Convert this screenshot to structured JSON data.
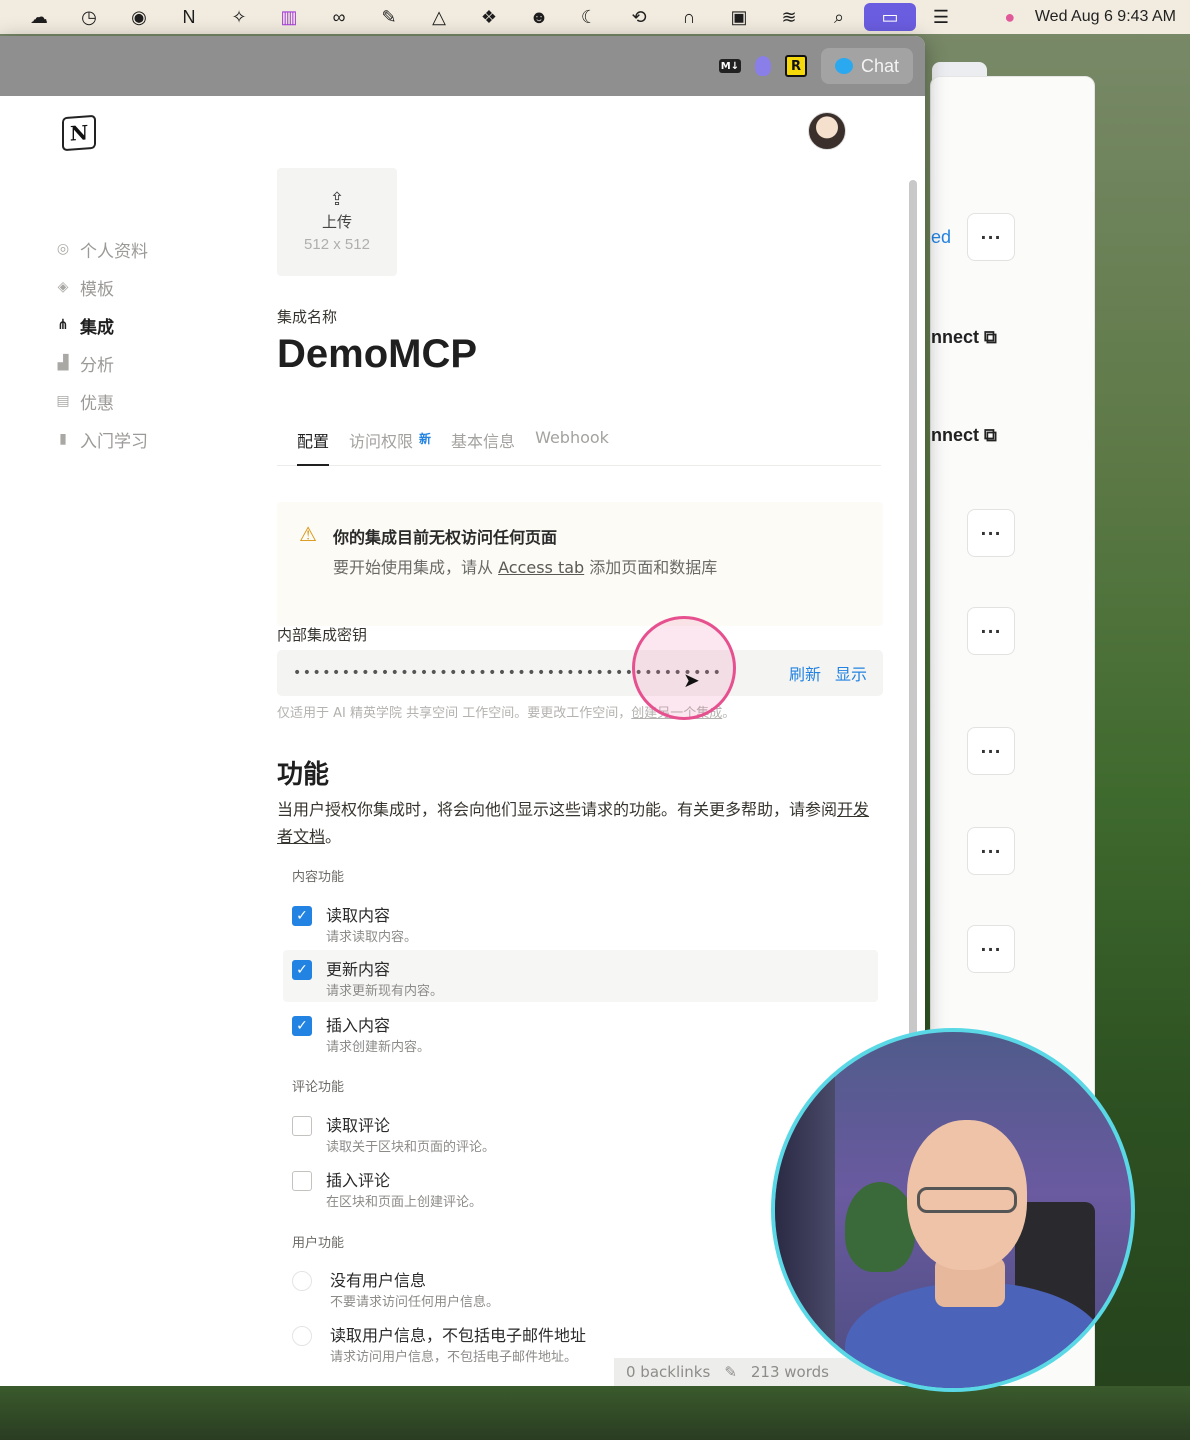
{
  "menubar": {
    "icons": [
      "creative-cloud-icon",
      "clock-icon",
      "pockity-icon",
      "notion-icon",
      "bartender-icon",
      "istat-icon",
      "link-icon",
      "pen-icon",
      "drive-icon",
      "dropbox-icon",
      "face-icon",
      "moon-icon",
      "time-machine-icon",
      "headphones-icon",
      "mirror-icon",
      "wifi-icon",
      "search-icon",
      "screen-share-icon",
      "control-center-icon",
      "siri-icon"
    ],
    "datetime": "Wed Aug 6  9:43 AM"
  },
  "toolbar": {
    "md_badge": "M↓",
    "r_badge": "R",
    "chat_label": "Chat"
  },
  "sidebar": {
    "items": [
      {
        "label": "个人资料",
        "icon": "person-icon"
      },
      {
        "label": "模板",
        "icon": "template-icon"
      },
      {
        "label": "集成",
        "icon": "integration-icon",
        "active": true
      },
      {
        "label": "分析",
        "icon": "analytics-icon"
      },
      {
        "label": "优惠",
        "icon": "offers-icon"
      },
      {
        "label": "入门学习",
        "icon": "book-icon"
      }
    ]
  },
  "upload": {
    "label": "上传",
    "size": "512 x 512"
  },
  "integration": {
    "name_label": "集成名称",
    "name": "DemoMCP"
  },
  "tabs": [
    {
      "label": "配置",
      "active": true
    },
    {
      "label": "访问权限",
      "badge": "新"
    },
    {
      "label": "基本信息"
    },
    {
      "label": "Webhook"
    }
  ],
  "warning": {
    "title": "你的集成目前无权访问任何页面",
    "body_prefix": "要开始使用集成，请从 ",
    "link": "Access tab",
    "body_suffix": " 添加页面和数据库"
  },
  "secret": {
    "label": "内部集成密钥",
    "masked": "••••••••••••••••••••••••••••••••••••••••••••",
    "refresh": "刷新",
    "show": "显示",
    "hint_prefix": "仅适用于 AI 精英学院 共享空间 工作空间。要更改工作空间，",
    "hint_link": "创建另一个集成",
    "hint_suffix": "。"
  },
  "features": {
    "title": "功能",
    "desc_prefix": "当用户授权你集成时，将会向他们显示这些请求的功能。有关更多帮助，请参阅",
    "desc_link": "开发者文档",
    "desc_suffix": "。",
    "content_label": "内容功能",
    "content": [
      {
        "title": "读取内容",
        "desc": "请求读取内容。",
        "checked": true
      },
      {
        "title": "更新内容",
        "desc": "请求更新现有内容。",
        "checked": true
      },
      {
        "title": "插入内容",
        "desc": "请求创建新内容。",
        "checked": true
      }
    ],
    "comment_label": "评论功能",
    "comment": [
      {
        "title": "读取评论",
        "desc": "读取关于区块和页面的评论。",
        "checked": false
      },
      {
        "title": "插入评论",
        "desc": "在区块和页面上创建评论。",
        "checked": false
      }
    ],
    "user_label": "用户功能",
    "user": [
      {
        "title": "没有用户信息",
        "desc": "不要请求访问任何用户信息。"
      },
      {
        "title": "读取用户信息，不包括电子邮件地址",
        "desc": "请求访问用户信息，不包括电子邮件地址。"
      }
    ]
  },
  "footer": {
    "backlinks": "0 backlinks",
    "words": "213 words"
  },
  "bg_window": {
    "fragments": [
      "ed",
      "nnect",
      "nnect"
    ],
    "more_label": "···"
  },
  "colors": {
    "accent": "#2383e2",
    "warning": "#d9930d",
    "cursor_ring": "#e6508f",
    "cam_border": "#5ad8e6",
    "menubar_active": "#6b5de0"
  }
}
